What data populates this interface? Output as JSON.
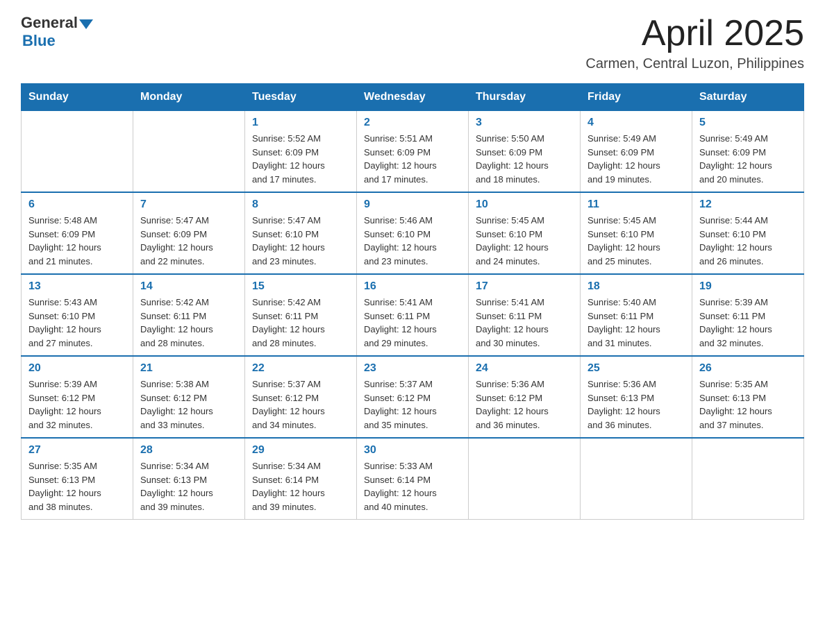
{
  "header": {
    "logo_general": "General",
    "logo_blue": "Blue",
    "title": "April 2025",
    "location": "Carmen, Central Luzon, Philippines"
  },
  "calendar": {
    "days_of_week": [
      "Sunday",
      "Monday",
      "Tuesday",
      "Wednesday",
      "Thursday",
      "Friday",
      "Saturday"
    ],
    "weeks": [
      [
        {
          "day": "",
          "info": ""
        },
        {
          "day": "",
          "info": ""
        },
        {
          "day": "1",
          "info": "Sunrise: 5:52 AM\nSunset: 6:09 PM\nDaylight: 12 hours\nand 17 minutes."
        },
        {
          "day": "2",
          "info": "Sunrise: 5:51 AM\nSunset: 6:09 PM\nDaylight: 12 hours\nand 17 minutes."
        },
        {
          "day": "3",
          "info": "Sunrise: 5:50 AM\nSunset: 6:09 PM\nDaylight: 12 hours\nand 18 minutes."
        },
        {
          "day": "4",
          "info": "Sunrise: 5:49 AM\nSunset: 6:09 PM\nDaylight: 12 hours\nand 19 minutes."
        },
        {
          "day": "5",
          "info": "Sunrise: 5:49 AM\nSunset: 6:09 PM\nDaylight: 12 hours\nand 20 minutes."
        }
      ],
      [
        {
          "day": "6",
          "info": "Sunrise: 5:48 AM\nSunset: 6:09 PM\nDaylight: 12 hours\nand 21 minutes."
        },
        {
          "day": "7",
          "info": "Sunrise: 5:47 AM\nSunset: 6:09 PM\nDaylight: 12 hours\nand 22 minutes."
        },
        {
          "day": "8",
          "info": "Sunrise: 5:47 AM\nSunset: 6:10 PM\nDaylight: 12 hours\nand 23 minutes."
        },
        {
          "day": "9",
          "info": "Sunrise: 5:46 AM\nSunset: 6:10 PM\nDaylight: 12 hours\nand 23 minutes."
        },
        {
          "day": "10",
          "info": "Sunrise: 5:45 AM\nSunset: 6:10 PM\nDaylight: 12 hours\nand 24 minutes."
        },
        {
          "day": "11",
          "info": "Sunrise: 5:45 AM\nSunset: 6:10 PM\nDaylight: 12 hours\nand 25 minutes."
        },
        {
          "day": "12",
          "info": "Sunrise: 5:44 AM\nSunset: 6:10 PM\nDaylight: 12 hours\nand 26 minutes."
        }
      ],
      [
        {
          "day": "13",
          "info": "Sunrise: 5:43 AM\nSunset: 6:10 PM\nDaylight: 12 hours\nand 27 minutes."
        },
        {
          "day": "14",
          "info": "Sunrise: 5:42 AM\nSunset: 6:11 PM\nDaylight: 12 hours\nand 28 minutes."
        },
        {
          "day": "15",
          "info": "Sunrise: 5:42 AM\nSunset: 6:11 PM\nDaylight: 12 hours\nand 28 minutes."
        },
        {
          "day": "16",
          "info": "Sunrise: 5:41 AM\nSunset: 6:11 PM\nDaylight: 12 hours\nand 29 minutes."
        },
        {
          "day": "17",
          "info": "Sunrise: 5:41 AM\nSunset: 6:11 PM\nDaylight: 12 hours\nand 30 minutes."
        },
        {
          "day": "18",
          "info": "Sunrise: 5:40 AM\nSunset: 6:11 PM\nDaylight: 12 hours\nand 31 minutes."
        },
        {
          "day": "19",
          "info": "Sunrise: 5:39 AM\nSunset: 6:11 PM\nDaylight: 12 hours\nand 32 minutes."
        }
      ],
      [
        {
          "day": "20",
          "info": "Sunrise: 5:39 AM\nSunset: 6:12 PM\nDaylight: 12 hours\nand 32 minutes."
        },
        {
          "day": "21",
          "info": "Sunrise: 5:38 AM\nSunset: 6:12 PM\nDaylight: 12 hours\nand 33 minutes."
        },
        {
          "day": "22",
          "info": "Sunrise: 5:37 AM\nSunset: 6:12 PM\nDaylight: 12 hours\nand 34 minutes."
        },
        {
          "day": "23",
          "info": "Sunrise: 5:37 AM\nSunset: 6:12 PM\nDaylight: 12 hours\nand 35 minutes."
        },
        {
          "day": "24",
          "info": "Sunrise: 5:36 AM\nSunset: 6:12 PM\nDaylight: 12 hours\nand 36 minutes."
        },
        {
          "day": "25",
          "info": "Sunrise: 5:36 AM\nSunset: 6:13 PM\nDaylight: 12 hours\nand 36 minutes."
        },
        {
          "day": "26",
          "info": "Sunrise: 5:35 AM\nSunset: 6:13 PM\nDaylight: 12 hours\nand 37 minutes."
        }
      ],
      [
        {
          "day": "27",
          "info": "Sunrise: 5:35 AM\nSunset: 6:13 PM\nDaylight: 12 hours\nand 38 minutes."
        },
        {
          "day": "28",
          "info": "Sunrise: 5:34 AM\nSunset: 6:13 PM\nDaylight: 12 hours\nand 39 minutes."
        },
        {
          "day": "29",
          "info": "Sunrise: 5:34 AM\nSunset: 6:14 PM\nDaylight: 12 hours\nand 39 minutes."
        },
        {
          "day": "30",
          "info": "Sunrise: 5:33 AM\nSunset: 6:14 PM\nDaylight: 12 hours\nand 40 minutes."
        },
        {
          "day": "",
          "info": ""
        },
        {
          "day": "",
          "info": ""
        },
        {
          "day": "",
          "info": ""
        }
      ]
    ]
  }
}
